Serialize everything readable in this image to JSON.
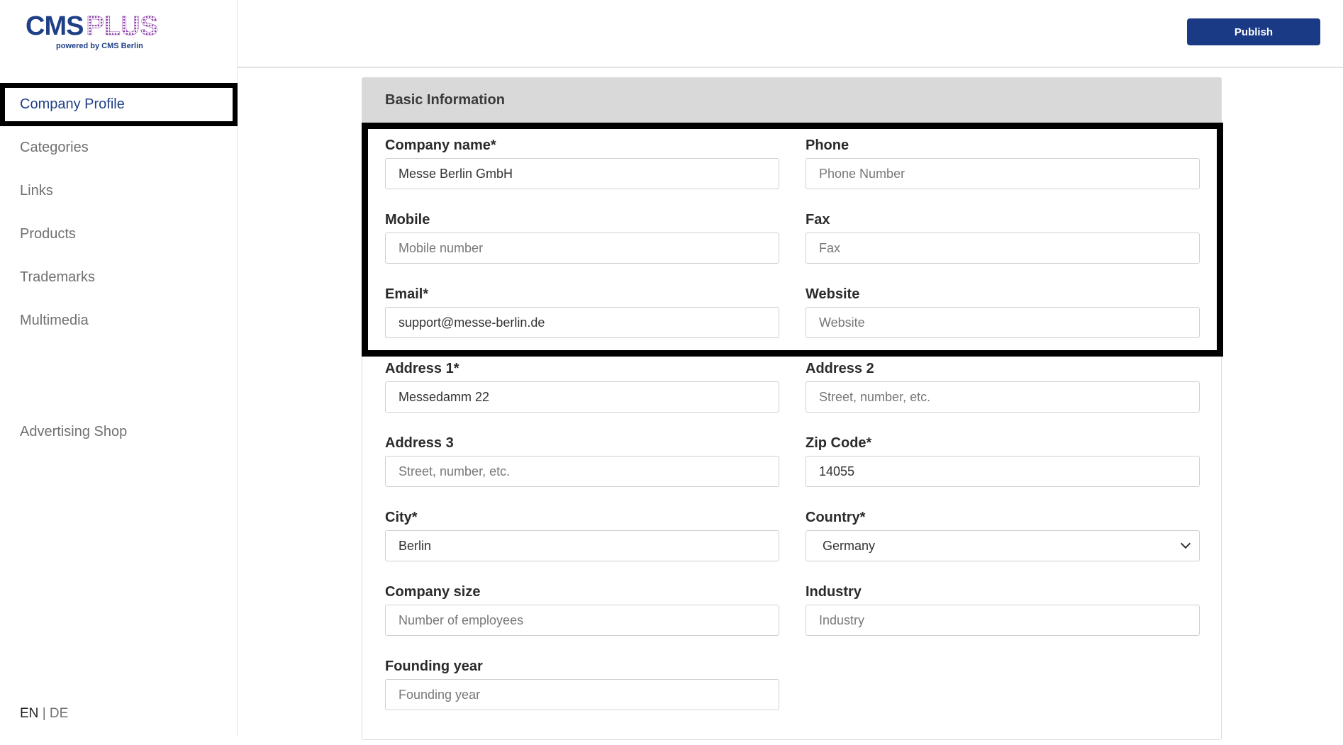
{
  "brand": {
    "logo_main": "CMS",
    "logo_accent": "PLUS",
    "logo_sub": "powered by CMS Berlin",
    "primary_color": "#1f3f87",
    "accent_color": "#8a3fa8"
  },
  "sidebar": {
    "items": [
      {
        "label": "Company Profile",
        "active": true
      },
      {
        "label": "Categories"
      },
      {
        "label": "Links"
      },
      {
        "label": "Products"
      },
      {
        "label": "Trademarks"
      },
      {
        "label": "Multimedia"
      }
    ],
    "shop_label": "Advertising Shop",
    "lang_current": "EN",
    "lang_separator": "|",
    "lang_other": "DE"
  },
  "topbar": {
    "publish_label": "Publish"
  },
  "card": {
    "title": "Basic Information"
  },
  "form": {
    "company_name": {
      "label": "Company name*",
      "value": "Messe Berlin GmbH",
      "placeholder": ""
    },
    "phone": {
      "label": "Phone",
      "value": "",
      "placeholder": "Phone Number"
    },
    "mobile": {
      "label": "Mobile",
      "value": "",
      "placeholder": "Mobile number"
    },
    "fax": {
      "label": "Fax",
      "value": "",
      "placeholder": "Fax"
    },
    "email": {
      "label": "Email*",
      "value": "support@messe-berlin.de",
      "placeholder": ""
    },
    "website": {
      "label": "Website",
      "value": "",
      "placeholder": "Website"
    },
    "address1": {
      "label": "Address 1*",
      "value": "Messedamm 22",
      "placeholder": ""
    },
    "address2": {
      "label": "Address 2",
      "value": "",
      "placeholder": "Street, number, etc."
    },
    "address3": {
      "label": "Address 3",
      "value": "",
      "placeholder": "Street, number, etc."
    },
    "zip": {
      "label": "Zip Code*",
      "value": "14055",
      "placeholder": ""
    },
    "city": {
      "label": "City*",
      "value": "Berlin",
      "placeholder": ""
    },
    "country": {
      "label": "Country*",
      "value": "Germany"
    },
    "company_size": {
      "label": "Company size",
      "value": "",
      "placeholder": "Number of employees"
    },
    "industry": {
      "label": "Industry",
      "value": "",
      "placeholder": "Industry"
    },
    "founding_year": {
      "label": "Founding year",
      "value": "",
      "placeholder": "Founding year"
    }
  }
}
